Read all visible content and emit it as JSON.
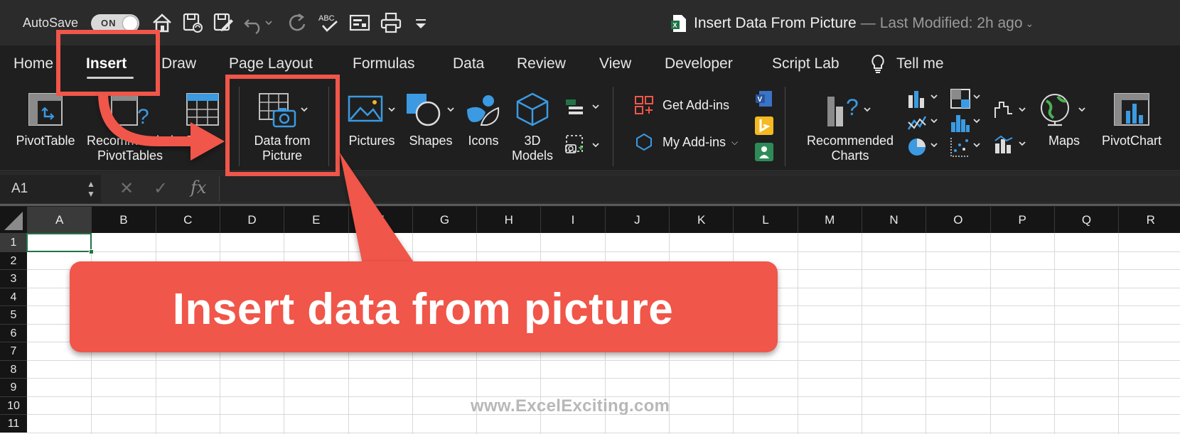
{
  "titlebar": {
    "autosave_label": "AutoSave",
    "toggle_text": "ON",
    "doc_title": "Insert Data From Picture",
    "separator": "—",
    "last_modified": "Last Modified: 2h ago"
  },
  "tabs": [
    "Home",
    "Insert",
    "Draw",
    "Page Layout",
    "Formulas",
    "Data",
    "Review",
    "View",
    "Developer",
    "Script Lab",
    "Tell me"
  ],
  "active_tab": "Insert",
  "ribbon": {
    "pivottable": "PivotTable",
    "recommended_pivottables_1": "Recommended",
    "recommended_pivottables_2": "PivotTables",
    "table": "Table",
    "data_from_picture_1": "Data from",
    "data_from_picture_2": "Picture",
    "pictures": "Pictures",
    "shapes": "Shapes",
    "icons": "Icons",
    "models_1": "3D",
    "models_2": "Models",
    "get_addins": "Get Add-ins",
    "my_addins": "My Add-ins",
    "recommended_charts_1": "Recommended",
    "recommended_charts_2": "Charts",
    "maps": "Maps",
    "pivotchart": "PivotChart"
  },
  "formula_bar": {
    "name_box": "A1",
    "cancel": "✕",
    "enter": "✓",
    "fx": "fx",
    "formula": ""
  },
  "grid": {
    "columns": [
      "A",
      "B",
      "C",
      "D",
      "E",
      "F",
      "G",
      "H",
      "I",
      "J",
      "K",
      "L",
      "M",
      "N",
      "O",
      "P",
      "Q",
      "R"
    ],
    "rows": [
      "1",
      "2",
      "3",
      "4",
      "5",
      "6",
      "7",
      "8",
      "9",
      "10",
      "11"
    ],
    "active_cell": "A1"
  },
  "callout": {
    "text": "Insert data from picture"
  },
  "watermark": "www.ExcelExciting.com",
  "colors": {
    "accent_red": "#f0564a",
    "excel_green": "#217346",
    "ribbon_bg": "#1f1f1f"
  }
}
